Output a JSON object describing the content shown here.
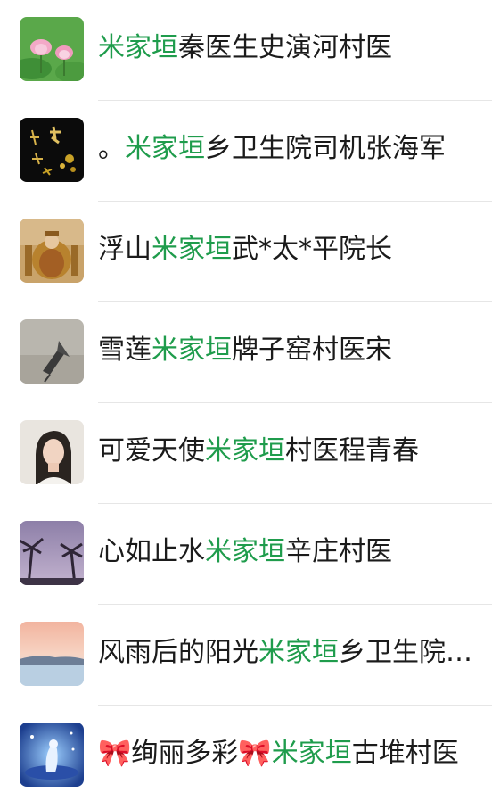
{
  "contacts": [
    {
      "prefix": "",
      "highlight": "米家垣",
      "suffix": "秦医生史演河村医",
      "avatar": "lotus-avatar"
    },
    {
      "prefix": "。",
      "highlight": "米家垣",
      "suffix": "乡卫生院司机张海军",
      "avatar": "calligraphy-avatar"
    },
    {
      "prefix": "浮山",
      "highlight": "米家垣",
      "suffix": "武*太*平院长",
      "avatar": "emperor-avatar"
    },
    {
      "prefix": "雪莲",
      "highlight": "米家垣",
      "suffix": "牌子窑村医宋",
      "avatar": "umbrella-avatar"
    },
    {
      "prefix": "可爱天使",
      "highlight": "米家垣",
      "suffix": "村医程青春",
      "avatar": "portrait-avatar"
    },
    {
      "prefix": "心如止水",
      "highlight": "米家垣",
      "suffix": "辛庄村医",
      "avatar": "palm-trees-avatar"
    },
    {
      "prefix": "风雨后的阳光",
      "highlight": "米家垣",
      "suffix": "乡卫生院…",
      "avatar": "sunset-sea-avatar"
    },
    {
      "prefix": "🎀绚丽多彩🎀",
      "highlight": "米家垣",
      "suffix": "古堆村医",
      "avatar": "fantasy-blue-avatar"
    }
  ],
  "colors": {
    "highlight": "#1f9c4c",
    "text": "#1b1b1b",
    "divider": "#e6e6e6"
  }
}
